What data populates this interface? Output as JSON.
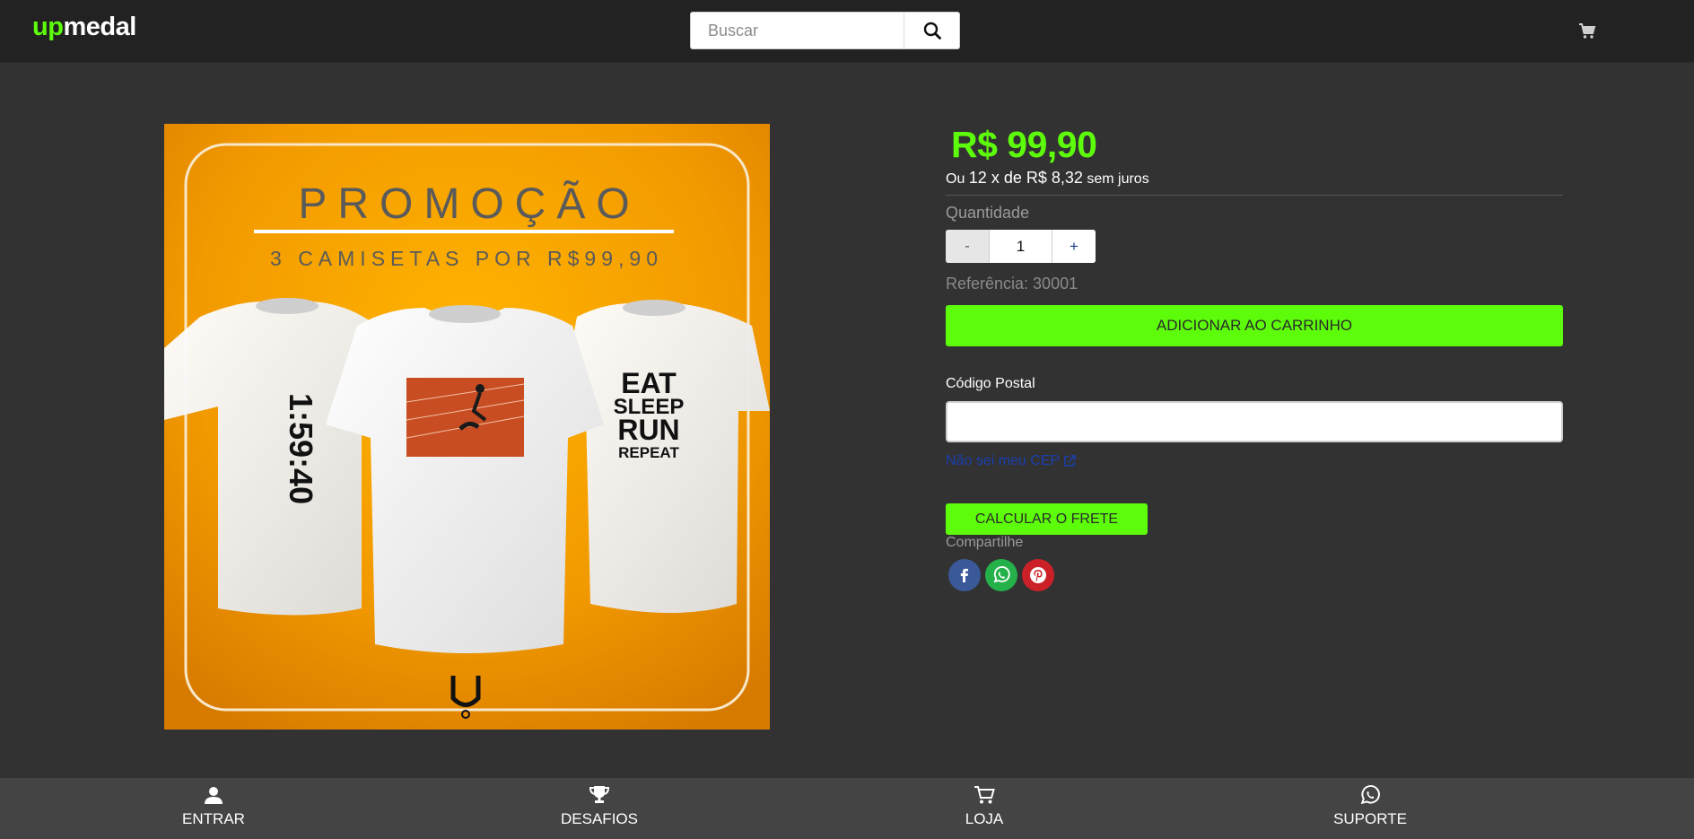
{
  "header": {
    "logo_part1": "up",
    "logo_part2": "medal",
    "search_placeholder": "Buscar",
    "search_icon": "search-icon",
    "cart_icon": "cart-icon"
  },
  "product": {
    "image": {
      "headline": "PROMOÇÃO",
      "subheadline": "3 CAMISETAS POR R$99,90",
      "shirt_left_text": "1:59:40",
      "shirt_right_lines": [
        "EAT",
        "SLEEP",
        "RUN",
        "REPEAT"
      ],
      "background_color": "#f0a000"
    },
    "price": "R$ 99,90",
    "installments_prefix": "Ou",
    "installments_count": "12 x de R$ 8,32",
    "installments_suffix": "sem juros",
    "quantity_label": "Quantidade",
    "quantity_minus": "-",
    "quantity_value": "1",
    "quantity_plus": "+",
    "reference": "Referência: 30001",
    "add_to_cart": "ADICIONAR AO CARRINHO",
    "postal_label": "Código Postal",
    "postal_value": "",
    "unknown_cep_link": "Não sei meu CEP",
    "calculate_shipping": "CALCULAR O FRETE",
    "share_label": "Compartilhe",
    "share_icons": [
      "facebook-icon",
      "whatsapp-icon",
      "pinterest-icon"
    ]
  },
  "bottom_nav": {
    "items": [
      {
        "label": "ENTRAR",
        "icon": "user-icon"
      },
      {
        "label": "DESAFIOS",
        "icon": "trophy-icon"
      },
      {
        "label": "LOJA",
        "icon": "cart-icon"
      },
      {
        "label": "SUPORTE",
        "icon": "whatsapp-icon"
      }
    ]
  },
  "colors": {
    "accent": "#5dfc0b",
    "topbar": "#222222",
    "background": "#323232",
    "bottombar": "#444444",
    "link": "#1a3fb0"
  }
}
